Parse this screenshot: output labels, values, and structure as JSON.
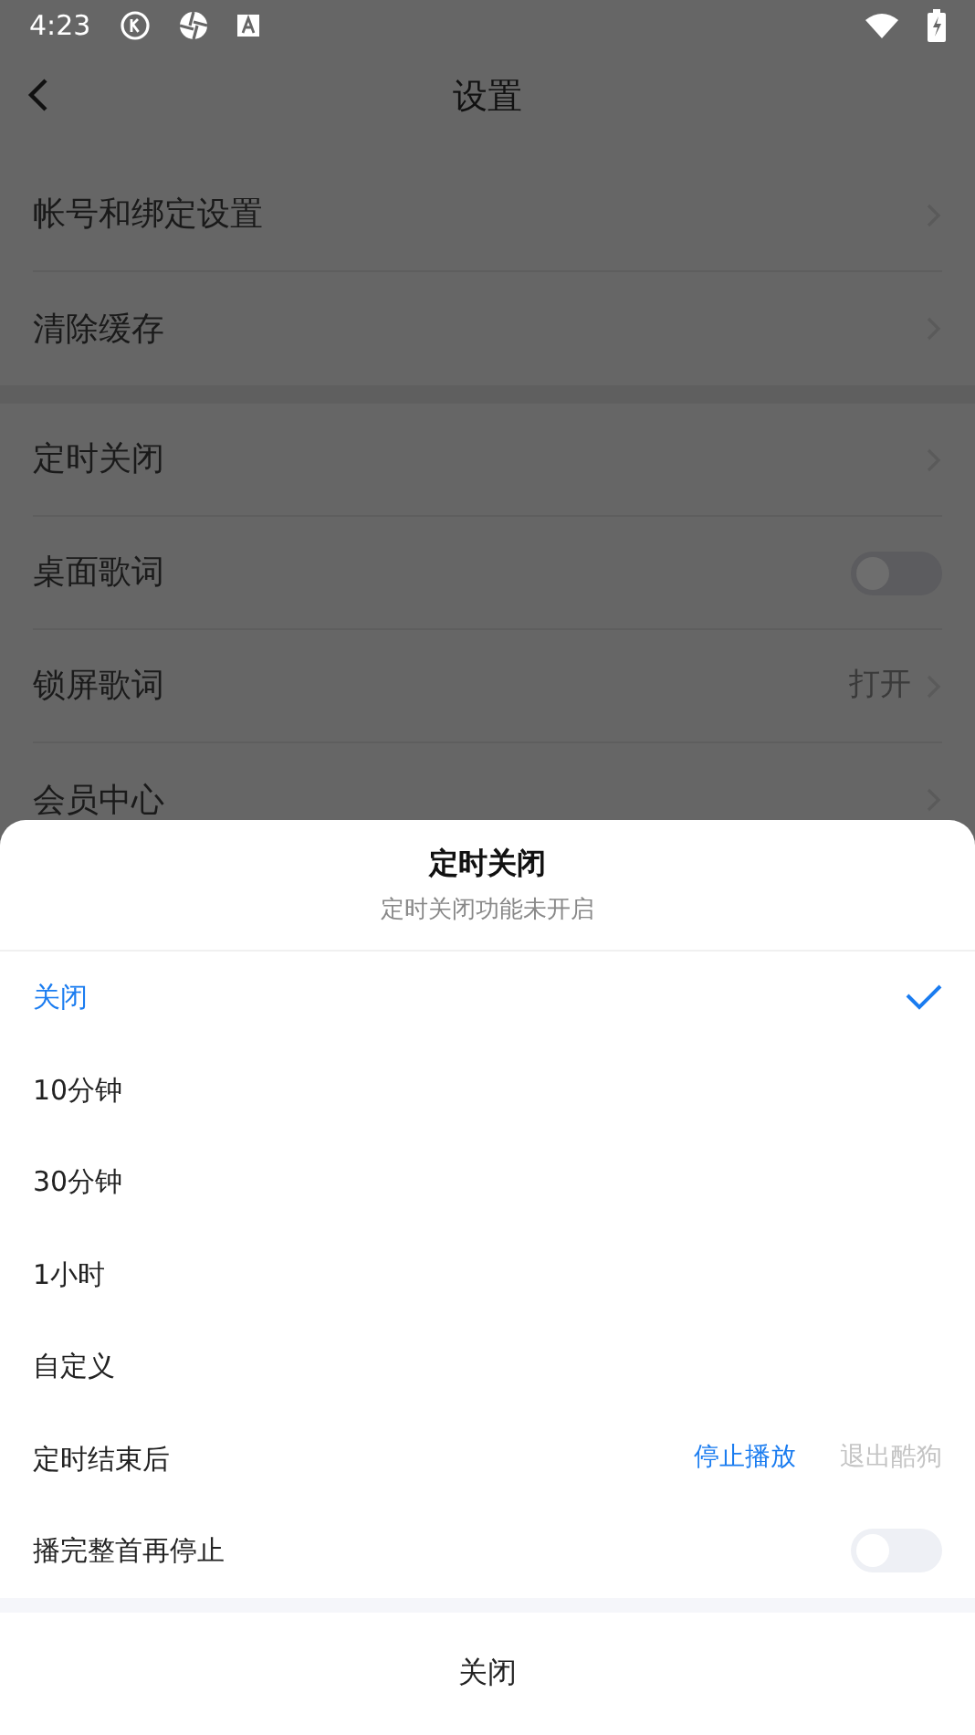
{
  "status_bar": {
    "time": "4:23"
  },
  "header": {
    "title": "设置"
  },
  "settings_groups": [
    {
      "items": [
        {
          "label": "帐号和绑定设置",
          "kind": "link"
        },
        {
          "label": "清除缓存",
          "kind": "link"
        }
      ]
    },
    {
      "items": [
        {
          "label": "定时关闭",
          "kind": "link"
        },
        {
          "label": "桌面歌词",
          "kind": "switch",
          "on": false
        },
        {
          "label": "锁屏歌词",
          "kind": "link",
          "value": "打开"
        },
        {
          "label": "会员中心",
          "kind": "link"
        }
      ]
    }
  ],
  "sheet": {
    "title": "定时关闭",
    "subtitle": "定时关闭功能未开启",
    "options": [
      {
        "label": "关闭",
        "selected": true
      },
      {
        "label": "10分钟",
        "selected": false
      },
      {
        "label": "30分钟",
        "selected": false
      },
      {
        "label": "1小时",
        "selected": false
      },
      {
        "label": "自定义",
        "selected": false
      }
    ],
    "after_timer": {
      "label": "定时结束后",
      "choices": [
        {
          "label": "停止播放",
          "selected": true
        },
        {
          "label": "退出酷狗",
          "selected": false
        }
      ]
    },
    "play_whole": {
      "label": "播完整首再停止",
      "on": false
    },
    "close_button": "关闭"
  }
}
